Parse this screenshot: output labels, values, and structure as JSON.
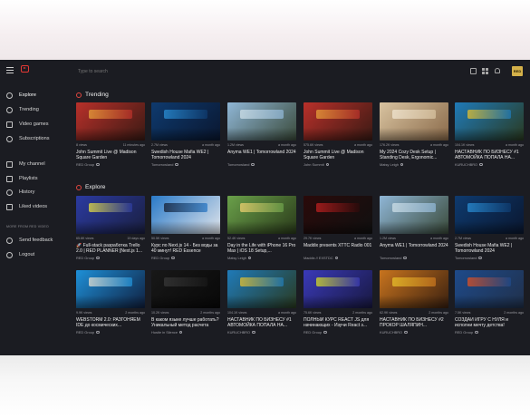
{
  "topbar": {
    "search_placeholder": "Type to search",
    "avatar_label": "RED"
  },
  "sidebar": {
    "items": [
      {
        "label": "Explore",
        "icon": "compass-icon",
        "active": true
      },
      {
        "label": "Trending",
        "icon": "flame-icon"
      },
      {
        "label": "Video games",
        "icon": "gamepad-icon"
      },
      {
        "label": "Subscriptions",
        "icon": "play-circle-icon"
      },
      {
        "label": "My channel",
        "icon": "user-icon"
      },
      {
        "label": "Playlists",
        "icon": "playlist-icon"
      },
      {
        "label": "History",
        "icon": "history-icon"
      },
      {
        "label": "Liked videos",
        "icon": "thumbs-up-icon"
      },
      {
        "label": "Send feedback",
        "icon": "feedback-icon"
      },
      {
        "label": "Logout",
        "icon": "logout-icon"
      }
    ],
    "more_heading": "MORE FROM RED VIDEO"
  },
  "sections": [
    {
      "title": "Trending",
      "videos": [
        {
          "views": "8 views",
          "ago": "11 minutes ago",
          "title": "John Summit Live @ Madison Square Garden",
          "channel": "RED Group",
          "thumb": [
            "#b8302a",
            "#e8a23a",
            "#3a1a14"
          ]
        },
        {
          "views": "2.7M views",
          "ago": "a month ago",
          "title": "Swedish House Mafia WE2 | Tomorrowland 2024",
          "channel": "Tomorrowland",
          "thumb": [
            "#0e3a6e",
            "#2a8fd6",
            "#0a1730"
          ]
        },
        {
          "views": "1.2M views",
          "ago": "a month ago",
          "title": "Anyma WE1 | Tomorrowland 2024",
          "channel": "Tomorrowland",
          "thumb": [
            "#8fb6d6",
            "#cfe0e8",
            "#3a4a3a"
          ]
        },
        {
          "views": "575.6K views",
          "ago": "a month ago",
          "title": "John Summit Live @ Madison Square Garden",
          "channel": "John Summit",
          "thumb": [
            "#b8302a",
            "#e8a23a",
            "#3a1a14"
          ]
        },
        {
          "views": "176.2K views",
          "ago": "a month ago",
          "title": "My 2024 Cozy Desk Setup | Standing Desk, Ergonomic...",
          "channel": "Matsy Leigh",
          "thumb": [
            "#d8c3a0",
            "#f1e6d2",
            "#8a6a4a"
          ]
        },
        {
          "views": "104.1K views",
          "ago": "a month ago",
          "title": "НАСТАВНИК ПО БИЗНЕСУ #1 АВТОМОЙКА ПОПАЛА НА...",
          "channel": "KURUCHBRO",
          "thumb": [
            "#1f7ab8",
            "#e8c12a",
            "#2a3a20"
          ]
        }
      ]
    },
    {
      "title": "Explore",
      "videos": [
        {
          "views": "65.6K views",
          "ago": "19 days ago",
          "title": "🚀 Full-stack разработка Trello 2.0 | RED PLANNER [Next.js 1...",
          "channel": "RED Group",
          "thumb": [
            "#2b3aa0",
            "#e8e040",
            "#1a1f40"
          ]
        },
        {
          "views": "50.5K views",
          "ago": "a month ago",
          "title": "Курс по Next.js 14 - Без воды за 40 минут! RED Essence",
          "channel": "RED Group",
          "thumb": [
            "#2a7ac8",
            "#151d30",
            "#e0e4ea"
          ]
        },
        {
          "views": "52.4K views",
          "ago": "a month ago",
          "title": "Day in the Life with iPhone 16 Pro Max | iOS 18 Setup,...",
          "channel": "Matsy Leigh",
          "thumb": [
            "#6aa04a",
            "#f0d070",
            "#2a3a1a"
          ]
        },
        {
          "views": "29.7K views",
          "ago": "a month ago",
          "title": "Maddix presents XTTC Radio 001",
          "channel": "Maddix // EXSTDC",
          "thumb": [
            "#2a0a0a",
            "#c02020",
            "#101010"
          ]
        },
        {
          "views": "1.2M views",
          "ago": "a month ago",
          "title": "Anyma WE1 | Tomorrowland 2024",
          "channel": "Tomorrowland",
          "thumb": [
            "#8fb6d6",
            "#cfe0e8",
            "#3a4a3a"
          ]
        },
        {
          "views": "2.7M views",
          "ago": "a month ago",
          "title": "Swedish House Mafia WE2 | Tomorrowland 2024",
          "channel": "Tomorrowland",
          "thumb": [
            "#0e3a6e",
            "#2a8fd6",
            "#0a1730"
          ]
        }
      ]
    },
    {
      "title": "",
      "videos": [
        {
          "views": "9.9K views",
          "ago": "2 months ago",
          "title": "WEBSTORM 2.0: РАЗГОНЯЕМ IDE до космических...",
          "channel": "RED Group",
          "thumb": [
            "#1e90d8",
            "#e8e0d0",
            "#102040"
          ]
        },
        {
          "views": "10.2K views",
          "ago": "2 months ago",
          "title": "В каком языке лучше работать? Уникальный метод расчета",
          "channel": "Hustle in Silence",
          "thumb": [
            "#181818",
            "#383838",
            "#080808"
          ]
        },
        {
          "views": "104.1K views",
          "ago": "a month ago",
          "title": "НАСТАВНИК ПО БИЗНЕСУ #1 АВТОМОЙКА ПОПАЛА НА...",
          "channel": "KURUCHBRO",
          "thumb": [
            "#1f7ab8",
            "#e8c12a",
            "#2a3a20"
          ]
        },
        {
          "views": "75.6K views",
          "ago": "2 months ago",
          "title": "ПОЛНЫЙ КУРС REACT JS для начинающих - Изучи React з...",
          "channel": "RED Group",
          "thumb": [
            "#3a3ab8",
            "#d8e020",
            "#181840"
          ]
        },
        {
          "views": "62.9K views",
          "ago": "2 months ago",
          "title": "НАСТАВНИК ПО БИЗНЕСУ #2 ПРОКОР ШАЛЯПИН...",
          "channel": "KURUCHBRO",
          "thumb": [
            "#c8741e",
            "#e8c12a",
            "#3a2010"
          ]
        },
        {
          "views": "7.5K views",
          "ago": "2 months ago",
          "title": "СОЗДАЙ ИГРУ С НУЛЯ и исполни мечту детства!",
          "channel": "RED Group",
          "thumb": [
            "#1e4a8a",
            "#e05020",
            "#20304a"
          ]
        }
      ]
    }
  ]
}
